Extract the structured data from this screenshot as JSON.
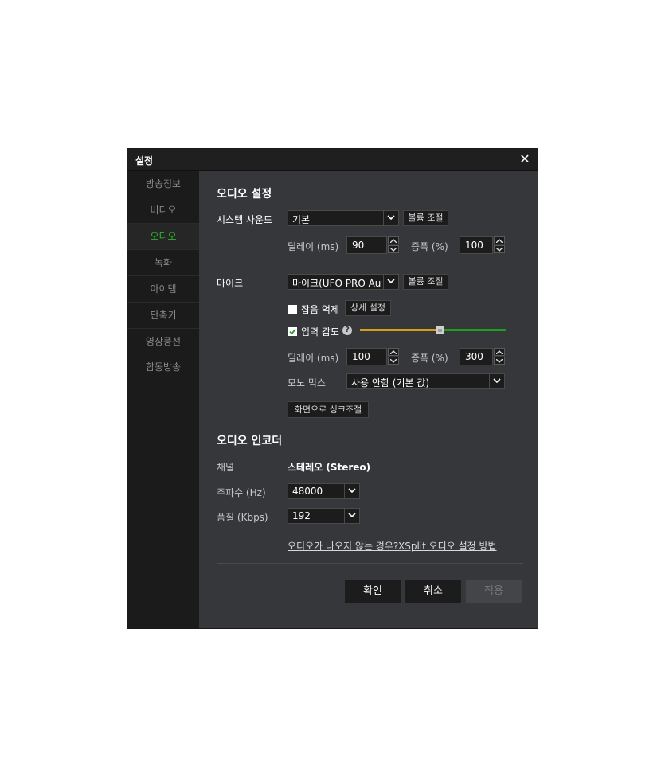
{
  "window": {
    "title": "설정"
  },
  "sidebar": {
    "items": [
      {
        "label": "방송정보"
      },
      {
        "label": "비디오"
      },
      {
        "label": "오디오"
      },
      {
        "label": "녹화"
      },
      {
        "label": "아이템"
      },
      {
        "label": "단축키"
      },
      {
        "label": "영상풍선"
      },
      {
        "label": "합동방송"
      }
    ],
    "active": "오디오"
  },
  "audio_settings": {
    "heading": "오디오 설정",
    "system_sound": {
      "label": "시스템 사운드",
      "device": "기본",
      "volume_button": "볼륨 조절",
      "delay_label": "딜레이 (ms)",
      "delay_value": "90",
      "gain_label": "증폭 (%)",
      "gain_value": "100"
    },
    "mic": {
      "label": "마이크",
      "device": "마이크(UFO PRO Au...",
      "volume_button": "볼륨 조절",
      "noise_label": "잡음 억제",
      "noise_checked": false,
      "detail_button": "상세 설정",
      "sensitivity_label": "입력 감도",
      "sensitivity_checked": true,
      "sensitivity_level": 0.55,
      "delay_label": "딜레이 (ms)",
      "delay_value": "100",
      "gain_label": "증폭 (%)",
      "gain_value": "300",
      "mono_label": "모노 믹스",
      "mono_value": "사용 안함 (기본 값)",
      "sync_button": "화면으로 싱크조절"
    }
  },
  "encoder": {
    "heading": "오디오 인코더",
    "channel_label": "채널",
    "channel_value": "스테레오 (Stereo)",
    "freq_label": "주파수 (Hz)",
    "freq_value": "48000",
    "quality_label": "품질 (Kbps)",
    "quality_value": "192"
  },
  "links": {
    "no_audio": "오디오가 나오지 않는 경우?",
    "xsplit": "XSplit 오디오 설정 방법"
  },
  "footer": {
    "ok": "확인",
    "cancel": "취소",
    "apply": "적용"
  },
  "colors": {
    "accent": "#29b629",
    "slider_left": "#d4a017",
    "slider_right": "#1e9e1e"
  }
}
